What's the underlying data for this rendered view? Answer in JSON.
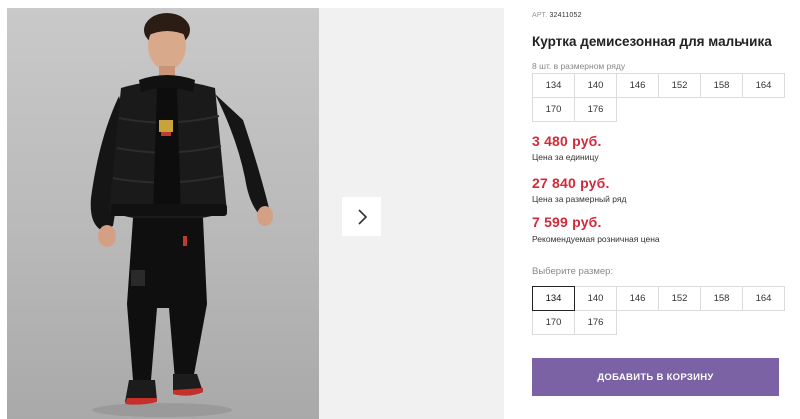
{
  "product": {
    "article_label": "АРТ.",
    "article_number": "32411052",
    "title": "Куртка демисезонная для мальчика",
    "image_alt": "boy in black jacket"
  },
  "gallery": {
    "next_icon": "chevron-right-icon"
  },
  "size_row": {
    "note": "8 шт. в размерном ряду",
    "sizes": [
      "134",
      "140",
      "146",
      "152",
      "158",
      "164",
      "170",
      "176"
    ]
  },
  "prices": {
    "unit_price": "3 480 руб.",
    "unit_label": "Цена за единицу",
    "row_price": "27 840 руб.",
    "row_label": "Цена за размерный ряд",
    "retail_price": "7 599 руб.",
    "retail_label": "Рекомендуемая розничная цена"
  },
  "size_select": {
    "label": "Выберите размер:",
    "sizes": [
      "134",
      "140",
      "146",
      "152",
      "158",
      "164",
      "170",
      "176"
    ],
    "selected": "134"
  },
  "cart": {
    "button_label": "ДОБАВИТЬ В КОРЗИНУ"
  },
  "colors": {
    "price": "#d12a3a",
    "button": "#7b62a4"
  }
}
